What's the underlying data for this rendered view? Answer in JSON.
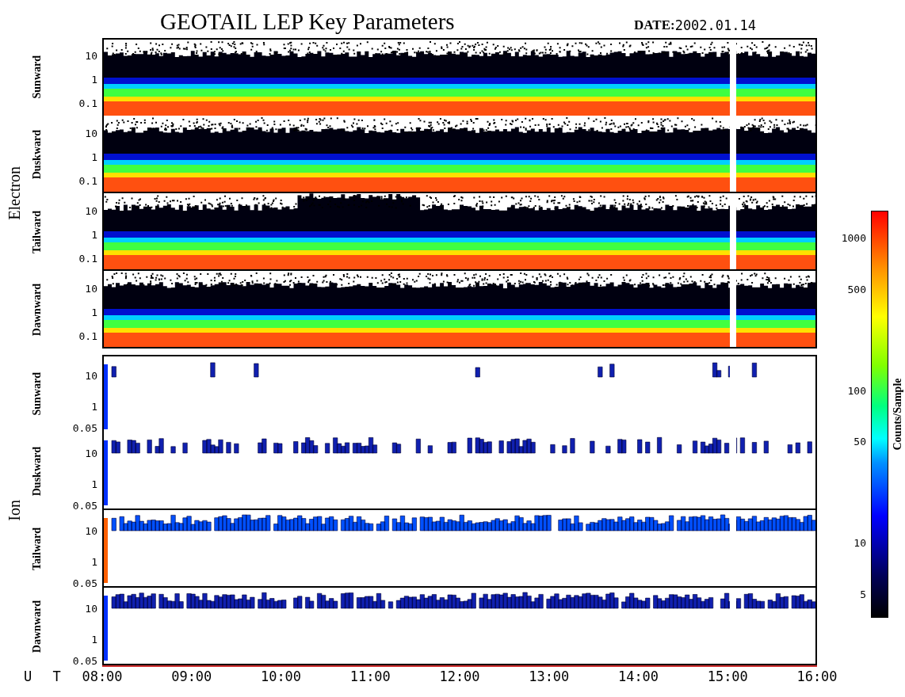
{
  "title": "GEOTAIL LEP Key Parameters",
  "date": {
    "label": "DATE:",
    "value": "2002.01.14"
  },
  "groups": [
    {
      "name": "Electron",
      "kind": "electron",
      "panels": [
        {
          "label": "Sunward",
          "yticks": [
            "10",
            "1",
            "0.1"
          ]
        },
        {
          "label": "Duskward",
          "yticks": [
            "10",
            "1",
            "0.1"
          ]
        },
        {
          "label": "Tailward",
          "yticks": [
            "10",
            "1",
            "0.1"
          ]
        },
        {
          "label": "Dawnward",
          "yticks": [
            "10",
            "1",
            "0.1"
          ]
        }
      ]
    },
    {
      "name": "Ion",
      "kind": "ion",
      "panels": [
        {
          "label": "Sunward",
          "yticks": [
            "10",
            "1",
            "0.05"
          ]
        },
        {
          "label": "Duskward",
          "yticks": [
            "10",
            "1",
            "0.05"
          ]
        },
        {
          "label": "Tailward",
          "yticks": [
            "10",
            "1",
            "0.05"
          ]
        },
        {
          "label": "Dawnward",
          "yticks": [
            "10",
            "1",
            "0.05"
          ]
        }
      ]
    }
  ],
  "colorbar": {
    "label": "Counts/Sample",
    "ticks": [
      "1000",
      "500",
      "100",
      "50",
      "10",
      "5"
    ]
  },
  "time_axis": {
    "label": "U T",
    "ticks": [
      "08:00",
      "09:00",
      "10:00",
      "11:00",
      "12:00",
      "13:00",
      "14:00",
      "15:00",
      "16:00"
    ]
  }
}
